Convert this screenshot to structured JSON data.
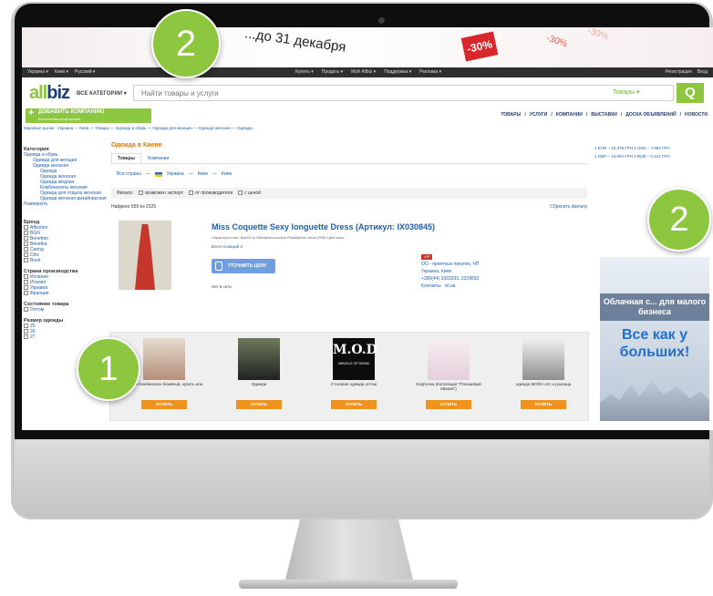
{
  "banner": {
    "promo_text": "...до 31 декабря",
    "sale_label": "-30%",
    "pct_a": "-30%",
    "pct_b": "-30%"
  },
  "topbar": {
    "left": [
      "Украина ▾",
      "Киев ▾",
      "Русский ▾"
    ],
    "center": [
      "Купить ▾",
      "Продать ▾",
      "Мой Allbiz ▾",
      "Поддержка ▾",
      "Реклама ▾"
    ],
    "right": [
      "Регистрация",
      "Вход"
    ]
  },
  "header": {
    "logo_green": "all",
    "logo_blue": "biz",
    "all_categories": "ВСЕ КАТЕГОРИИ ▾",
    "search_placeholder": "Найти товары и услуги",
    "search_scope": "Товары ▾",
    "search_icon": "search-icon"
  },
  "nav": {
    "add_company": "ДОБАВИТЬ КОМПАНИЮ",
    "add_company_sub": "Бесплатная регистрация",
    "tabs": [
      "ТОВАРЫ",
      "/",
      "УСЛУГИ",
      "/",
      "КОМПАНИИ",
      "/",
      "ВЫСТАВКИ",
      "/",
      "ДОСКА ОБЪЯВЛЕНИЙ",
      "/",
      "НОВОСТИ"
    ]
  },
  "breadcrumbs": "Мировые рынки : Украина — Киев — Товары — Одежда и обувь — Одежда для женщин — Одежда женская — Одежда",
  "sidebar": {
    "category_heading": "Категория",
    "categories": [
      "Одежда и обувь",
      "Одежда для женщин",
      "Одежда женская",
      "Одежда",
      "Одежда женская",
      "Одежда модная",
      "Комбинезоны женские",
      "Одежда для отдыха женская",
      "Одежда женская дизайнерская"
    ],
    "more": "Развернуть",
    "brand_heading": "Бренд",
    "brands": [
      "Affection",
      "BGN",
      "Benetton",
      "Benetka",
      "Caring",
      "Chic",
      "Bosh"
    ],
    "country_heading": "Страна производства",
    "countries": [
      "Испания",
      "Италия",
      "Украина",
      "Франция"
    ],
    "state_heading": "Состояние товара",
    "states": [
      "Оптом"
    ],
    "size_heading": "Размер одежды",
    "sizes": [
      "25",
      "26",
      "27"
    ]
  },
  "main": {
    "section_title": "Одежда в Киеве",
    "tab_products": "Товары",
    "tab_companies": "Компании",
    "all_countries": "Все страны",
    "country": "Украина",
    "city": "Киев",
    "city2": "Киев",
    "filter_label": "Фильтр:",
    "filter_export": "возможен экспорт",
    "filter_manufacturer": "от производителя",
    "filter_price": "с ценой",
    "found": "Найдено 559 из 2325",
    "reset": "Сбросить фильтр"
  },
  "product": {
    "title": "Miss Coquette Sexy longuette Dress (Артикул: IX030845)",
    "desc": "Характеристики: Bax03 xc Материал:шифон Размерная сетка (S/M) Цвет:крас...",
    "more": "Всего позиций 3",
    "price_button": "УТОЧНИТЬ ЦЕНУ",
    "online": "Нет в сети",
    "vip": "VIP",
    "seller": "ОО - приятных покупок, ЧП",
    "location": "Украина, Киев",
    "phone": "+380(44) 3333333, 3329652",
    "contacts": "Контакты",
    "site": "ixl.ua"
  },
  "related": [
    {
      "caption": "Майка Комбинезон бежевый, купить или",
      "buy": "КУПИТЬ"
    },
    {
      "caption": "Одежда",
      "buy": "КУПИТЬ"
    },
    {
      "caption": "Стоковая одежда оптом",
      "buy": "КУПИТЬ",
      "brand_text": "M.O.D",
      "brand_sub": "MIRACLE OF DENIM"
    },
    {
      "caption": "Кофточка (Коллекция \"Плюшевый Мишка\")",
      "buy": "КУПИТЬ"
    },
    {
      "caption": "одежда MORA опт и розница",
      "buy": "КУПИТЬ"
    }
  ],
  "rates": {
    "line1": "1 EUR – 10.379 ГРН  1 USD – 7.993 ГРН",
    "line2": "1 GBP – 13.064 ГРН  1 RUB – 0.241 ГРН"
  },
  "ad": {
    "stripe": "Облачная с... для малого бизнеса",
    "headline": "Все как у больших!"
  },
  "badges": {
    "top": "2",
    "right": "2",
    "left": "1"
  },
  "colors": {
    "accent_green": "#8dc63f",
    "brand_blue": "#1f3f74",
    "link_blue": "#1f5fa8",
    "buy_orange": "#f0921e"
  }
}
